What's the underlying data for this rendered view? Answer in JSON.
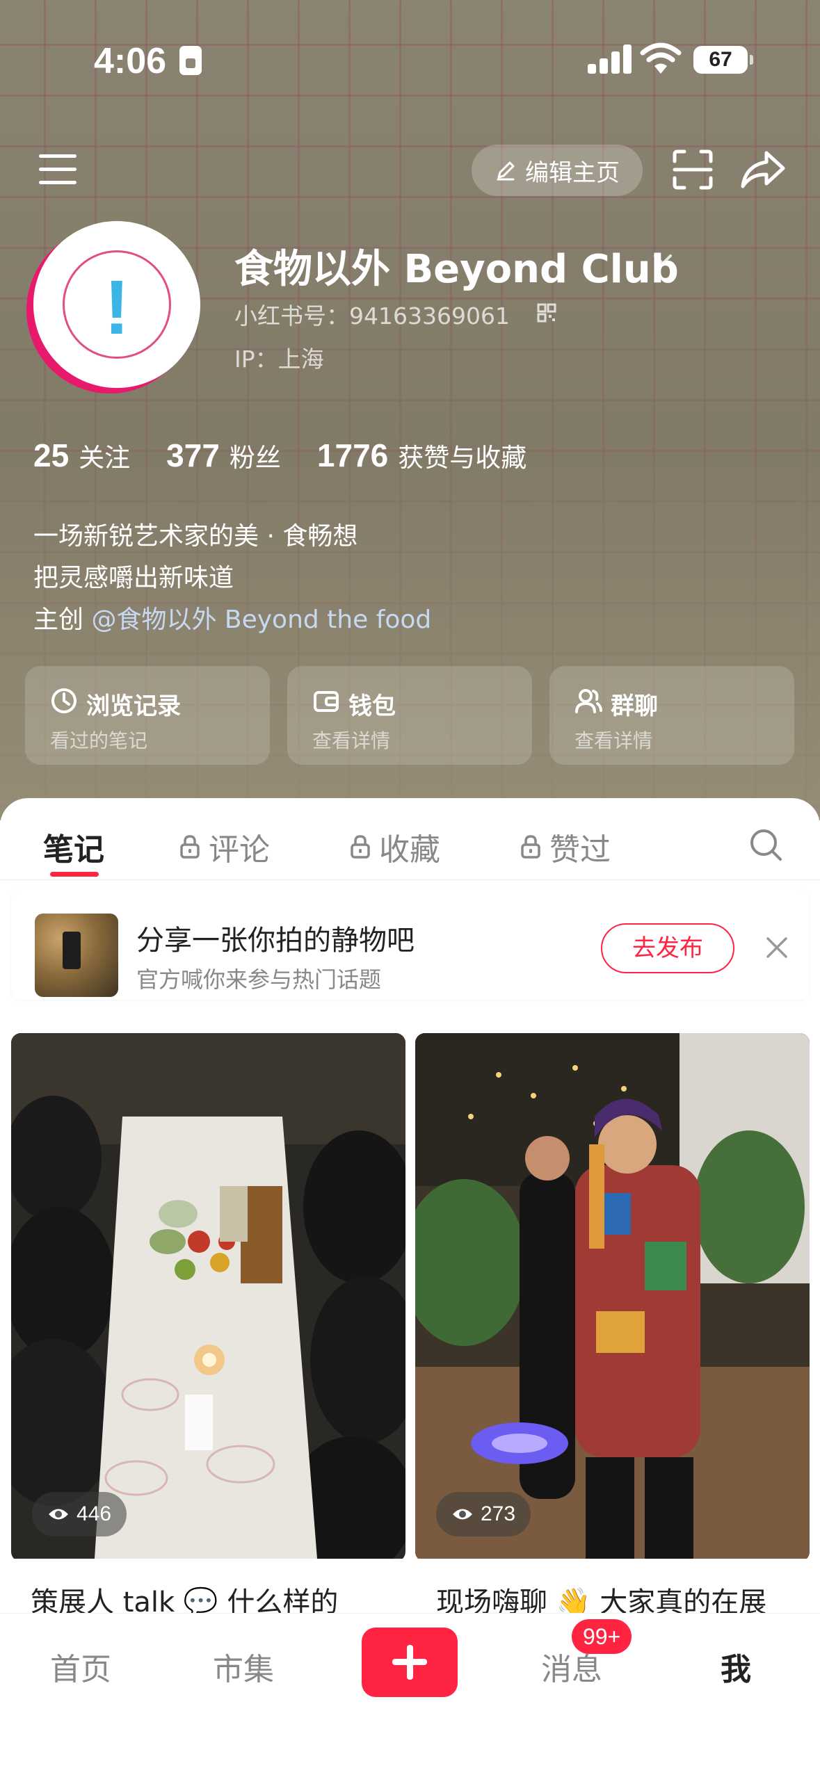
{
  "status_bar": {
    "time": "4:06",
    "battery": "67"
  },
  "header": {
    "edit_label": "编辑主页"
  },
  "profile": {
    "name": "食物以外 Beyond Club",
    "id_text": "小红书号：94163369061",
    "ip_text": "IP：上海",
    "stats": [
      {
        "number": "25",
        "label": "关注"
      },
      {
        "number": "377",
        "label": "粉丝"
      },
      {
        "number": "1776",
        "label": "获赞与收藏"
      }
    ],
    "bio": {
      "line1": "一场新锐艺术家的美 · 食畅想",
      "line2": "把灵感嚼出新味道",
      "line3_prefix": "主创 ",
      "line3_mention": "@食物以外 Beyond the food"
    }
  },
  "quick_actions": [
    {
      "title": "浏览记录",
      "subtitle": "看过的笔记",
      "icon": "clock-icon"
    },
    {
      "title": "钱包",
      "subtitle": "查看详情",
      "icon": "wallet-icon"
    },
    {
      "title": "群聊",
      "subtitle": "查看详情",
      "icon": "group-icon"
    }
  ],
  "content_tabs": [
    {
      "label": "笔记",
      "locked": false
    },
    {
      "label": "评论",
      "locked": true
    },
    {
      "label": "收藏",
      "locked": true
    },
    {
      "label": "赞过",
      "locked": true
    }
  ],
  "prompt_card": {
    "title": "分享一张你拍的静物吧",
    "subtitle": "官方喊你来参与热门话题",
    "button": "去发布"
  },
  "feed": [
    {
      "views": "446",
      "title": "策展人 talk 💬 什么样的"
    },
    {
      "views": "273",
      "title": "现场嗨聊 👋 大家真的在展"
    }
  ],
  "tabbar": {
    "items": [
      "首页",
      "市集",
      "消息",
      "我"
    ],
    "badge": "99+"
  },
  "colors": {
    "accent": "#ff2442",
    "header_bg": "#8e8775"
  }
}
